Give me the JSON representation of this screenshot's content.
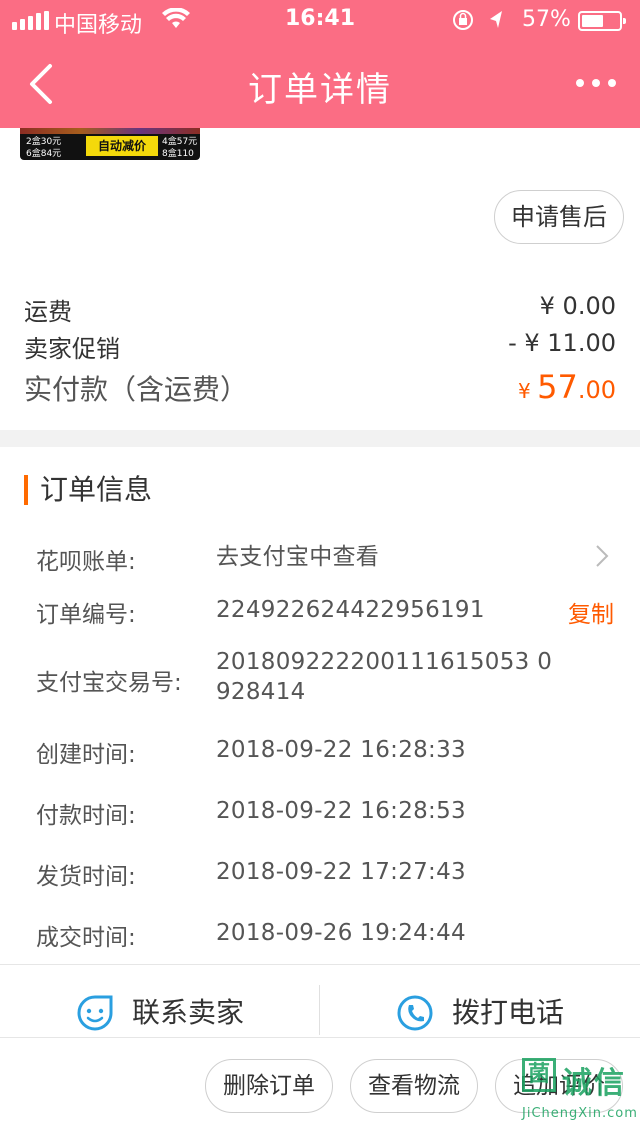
{
  "status_bar": {
    "carrier": "中国移动",
    "time": "16:41",
    "battery_percent": "57%",
    "battery_level": 0.57,
    "icons": [
      "signal-icon",
      "wifi-icon",
      "rotation-lock-icon",
      "location-arrow-icon",
      "battery-icon"
    ]
  },
  "nav": {
    "title": "订单详情",
    "back_icon": "chevron-left-icon",
    "more_icon": "more-dots-icon"
  },
  "product": {
    "promo_text": "自动减价",
    "price_tiers": [
      "2盒30元",
      "6盒84元",
      "4盒57元",
      "8盒110元"
    ]
  },
  "aftersale_label": "申请售后",
  "fees": {
    "shipping_label": "运费",
    "shipping_value": "¥ 0.00",
    "promo_label": "卖家促销",
    "promo_value": "- ¥ 11.00",
    "total_label": "实付款（含运费）",
    "total_currency": "¥ ",
    "total_int": "57",
    "total_dec": ".00"
  },
  "order_info": {
    "title": "订单信息",
    "huabei_label": "花呗账单:",
    "huabei_value": "去支付宝中查看",
    "order_no_label": "订单编号:",
    "order_no_value": "224922624422956191",
    "copy_label": "复制",
    "alipay_no_label": "支付宝交易号:",
    "alipay_no_line1": "201809222200111615053 0",
    "alipay_no_line2": "928414",
    "created_label": "创建时间:",
    "created_value": "2018-09-22 16:28:33",
    "paid_label": "付款时间:",
    "paid_value": "2018-09-22 16:28:53",
    "shipped_label": "发货时间:",
    "shipped_value": "2018-09-22 17:27:43",
    "completed_label": "成交时间:",
    "completed_value": "2018-09-26 19:24:44"
  },
  "contact": {
    "seller_label": "联系卖家",
    "phone_label": "拨打电话"
  },
  "actions": {
    "delete_label": "删除订单",
    "logistics_label": "查看物流",
    "review_label": "追加评价"
  },
  "watermark": {
    "logo_char": "菌",
    "cn": "诚信",
    "en": "JiChengXin.com"
  },
  "colors": {
    "header": "#fb6d84",
    "accent": "#ff5a00",
    "icon_blue": "#2a9fe0"
  }
}
